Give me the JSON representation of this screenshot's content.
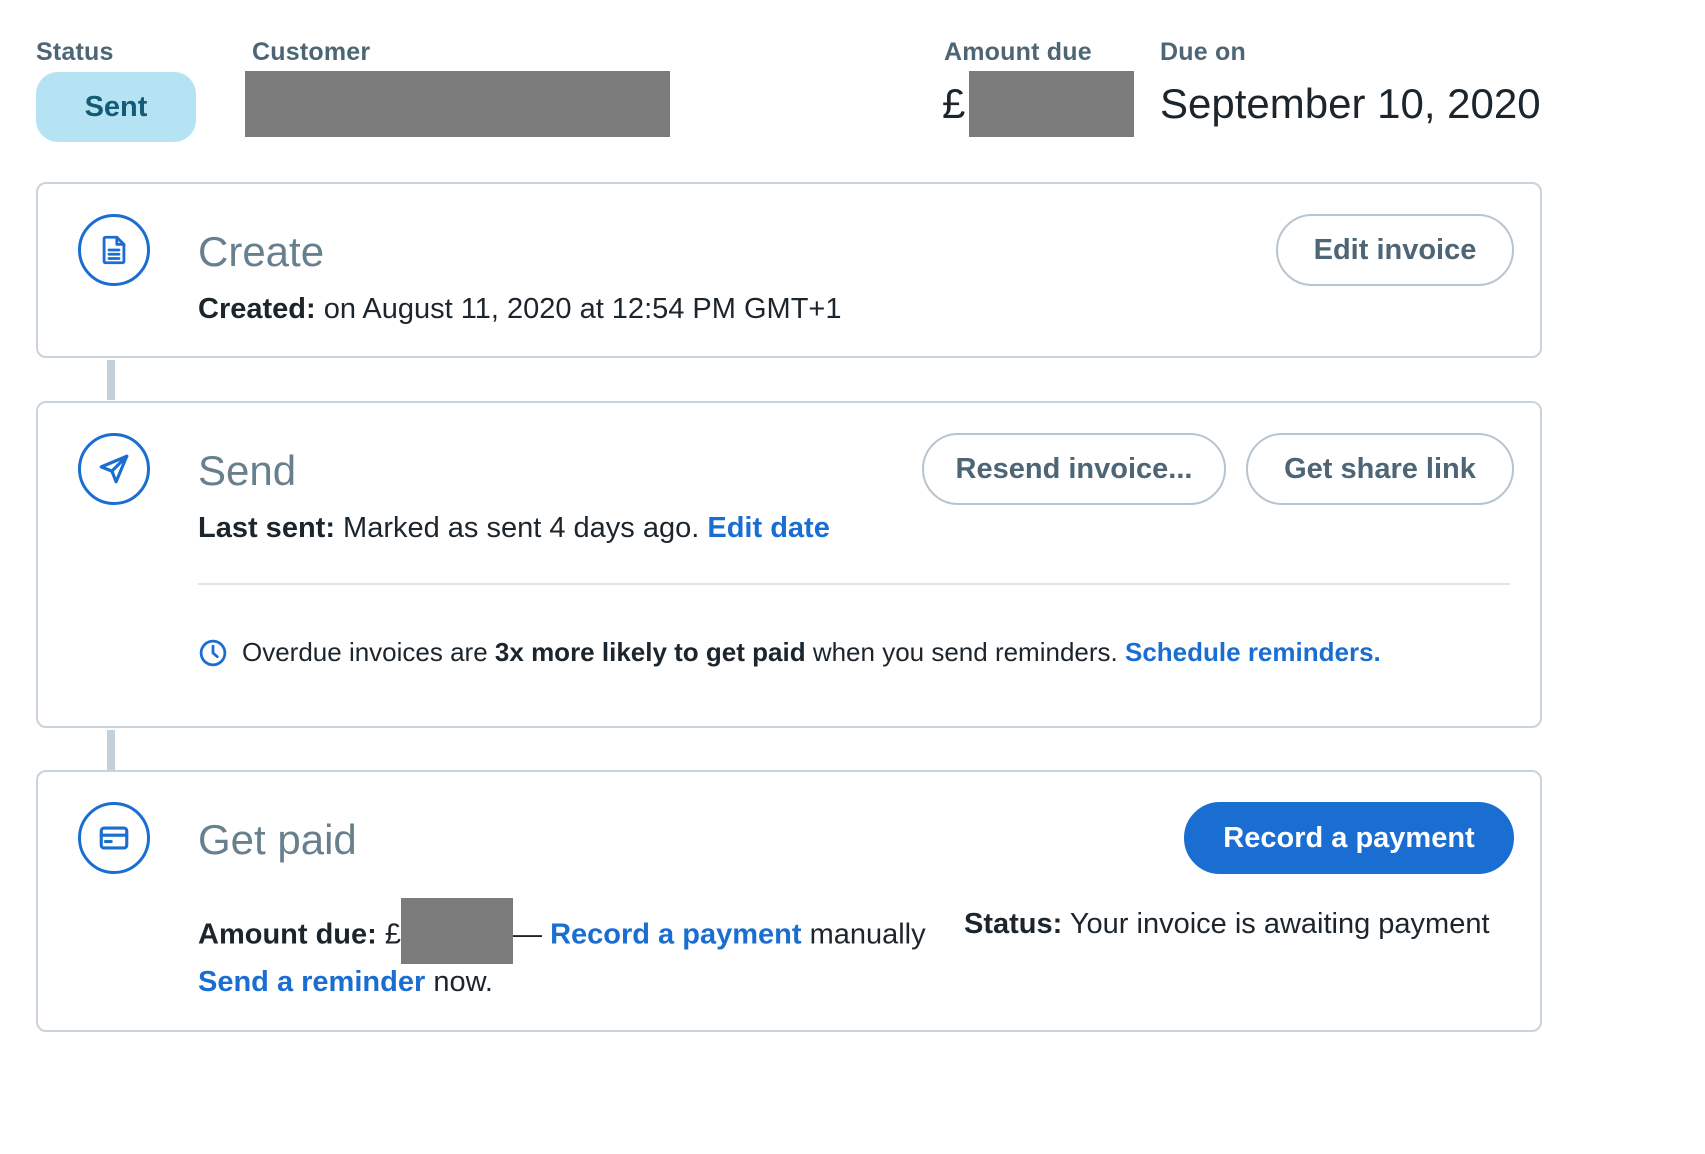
{
  "header": {
    "status_label": "Status",
    "status_value": "Sent",
    "customer_label": "Customer",
    "amount_due_label": "Amount due",
    "amount_currency": "£",
    "due_on_label": "Due on",
    "due_on_value": "September 10, 2020"
  },
  "create": {
    "title": "Create",
    "created_label": "Created:",
    "created_value": "on August 11, 2020 at 12:54 PM GMT+1",
    "edit_button": "Edit invoice",
    "icon": "document-icon"
  },
  "send": {
    "title": "Send",
    "last_sent_label": "Last sent:",
    "last_sent_value": "Marked as sent 4 days ago.",
    "edit_date_link": "Edit date",
    "resend_button": "Resend invoice...",
    "share_button": "Get share link",
    "tip_prefix": "Overdue invoices are",
    "tip_bold": "3x more likely to get paid",
    "tip_suffix": "when you send reminders.",
    "tip_link": "Schedule reminders.",
    "icon": "paper-plane-icon"
  },
  "get_paid": {
    "title": "Get paid",
    "record_button": "Record a payment",
    "amount_due_label": "Amount due:",
    "amount_currency": "£",
    "dash": "—",
    "record_link": "Record a payment",
    "manually_text": "manually",
    "status_label": "Status:",
    "status_value": "Your invoice is awaiting payment",
    "reminder_link": "Send a reminder",
    "reminder_suffix": "now.",
    "icon": "credit-card-icon"
  },
  "colors": {
    "accent": "#1a6ed1",
    "status_pill_bg": "#b5e3f4",
    "status_pill_text": "#145a75",
    "border": "#c9d3db",
    "redaction": "#7b7b7b"
  }
}
